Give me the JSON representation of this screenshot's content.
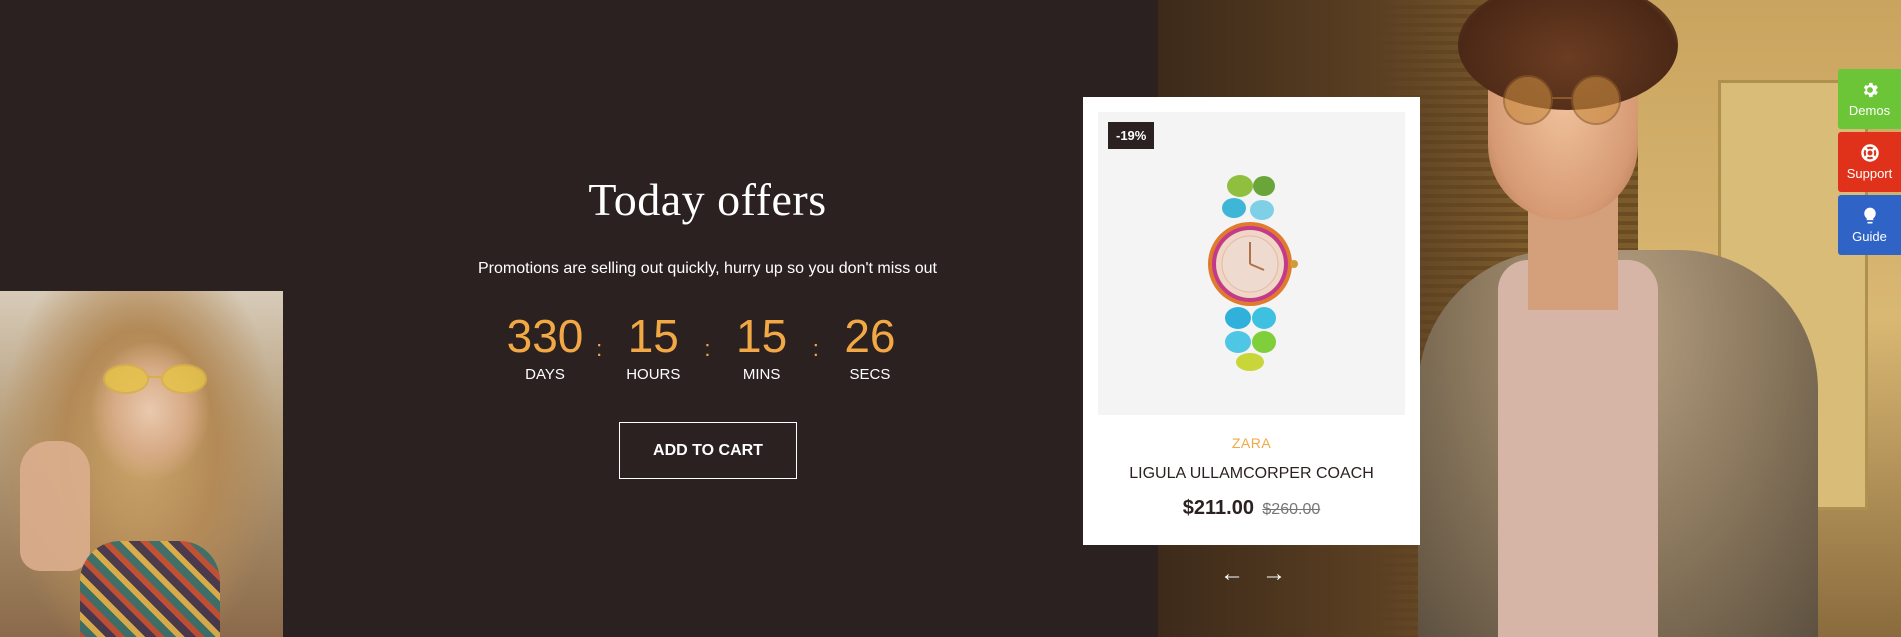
{
  "offer": {
    "title": "Today offers",
    "subtitle": "Promotions are selling out quickly, hurry up so you don't miss out",
    "cta_label": "ADD TO CART"
  },
  "countdown": {
    "days": "330",
    "days_label": "DAYS",
    "hours": "15",
    "hours_label": "HOURS",
    "mins": "15",
    "mins_label": "MINS",
    "secs": "26",
    "secs_label": "SECS",
    "separator": ":"
  },
  "product": {
    "badge": "-19%",
    "brand": "ZARA",
    "name": "LIGULA ULLAMCORPER COACH",
    "price": "$211.00",
    "old_price": "$260.00"
  },
  "carousel": {
    "prev_icon": "arrow-left-icon",
    "next_icon": "arrow-right-icon",
    "prev": "←",
    "next": "→"
  },
  "tools": [
    {
      "label": "Demos",
      "icon": "gear-icon",
      "color": "#6cc437"
    },
    {
      "label": "Support",
      "icon": "lifebuoy-icon",
      "color": "#e0321b"
    },
    {
      "label": "Guide",
      "icon": "lightbulb-icon",
      "color": "#2f63c6"
    }
  ],
  "colors": {
    "background": "#2b2120",
    "accent": "#f2a945"
  }
}
